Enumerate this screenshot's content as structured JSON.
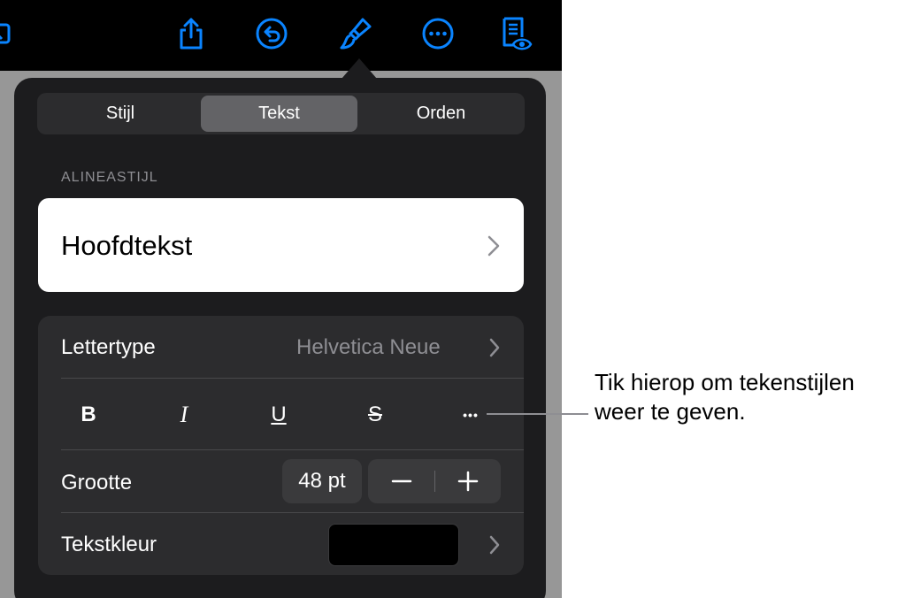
{
  "colors": {
    "accent": "#0a84ff",
    "panel": "#1c1c1e",
    "group": "#2c2c2e",
    "secondary_text": "#8e8e93"
  },
  "toolbar": {
    "icons": [
      "image-icon",
      "share-icon",
      "undo-icon",
      "format-brush-icon",
      "more-icon",
      "document-view-icon"
    ]
  },
  "tabs": [
    {
      "label": "Stijl",
      "selected": false
    },
    {
      "label": "Tekst",
      "selected": true
    },
    {
      "label": "Orden",
      "selected": false
    }
  ],
  "paragraph_style": {
    "section_label": "ALINEASTIJL",
    "value": "Hoofdtekst"
  },
  "font": {
    "label": "Lettertype",
    "value": "Helvetica Neue"
  },
  "format_buttons": {
    "bold": "B",
    "italic": "I",
    "underline": "U",
    "strikethrough": "S",
    "more": "•••"
  },
  "size": {
    "label": "Grootte",
    "value": "48 pt",
    "decrement": "−",
    "increment": "+"
  },
  "text_color": {
    "label": "Tekstkleur",
    "value": "#000000"
  },
  "callout": {
    "line1": "Tik hierop om tekenstijlen",
    "line2": "weer te geven."
  }
}
